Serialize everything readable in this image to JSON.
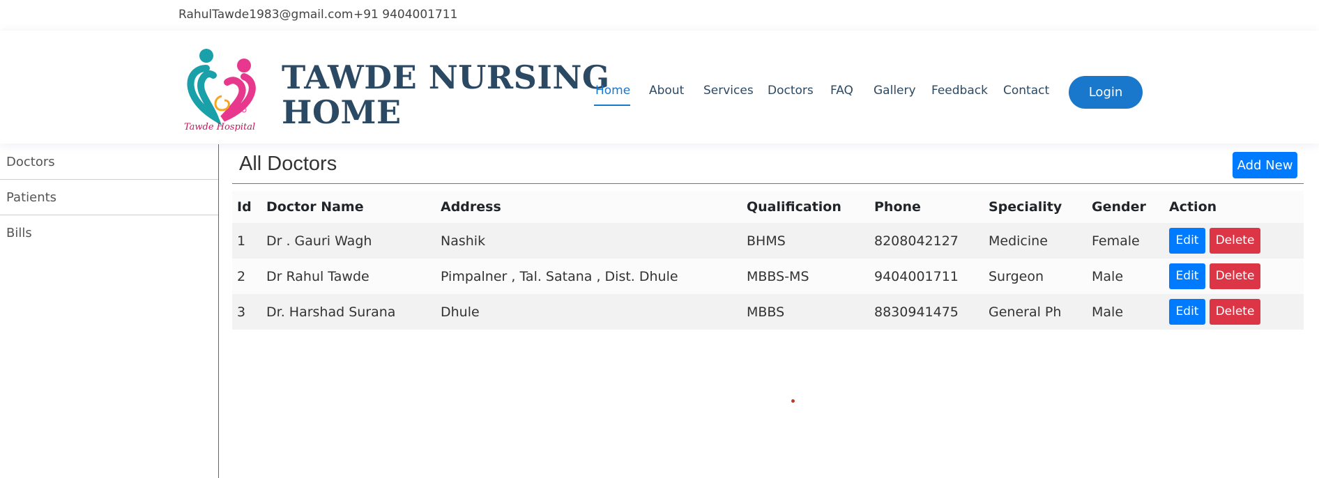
{
  "topbar": {
    "email": "RahulTawde1983@gmail.com",
    "phone": "+91 9404001711"
  },
  "header": {
    "brand_line1": "TAWDE NURSING",
    "brand_line2": "HOME",
    "logo_caption": "Tawde Hospital",
    "nav": [
      "Home",
      "About",
      "Services",
      "Doctors",
      "FAQ",
      "Gallery",
      "Feedback",
      "Contact"
    ],
    "active_nav": "Home",
    "login_label": "Login"
  },
  "sidebar": {
    "items": [
      {
        "label": "Doctors"
      },
      {
        "label": "Patients"
      },
      {
        "label": "Bills"
      }
    ]
  },
  "main": {
    "title": "All Doctors",
    "add_label": "Add New",
    "columns": [
      "Id",
      "Doctor Name",
      "Address",
      "Qualification",
      "Phone",
      "Speciality",
      "Gender",
      "Action"
    ],
    "rows": [
      {
        "id": "1",
        "name": "Dr . Gauri Wagh",
        "address": "Nashik",
        "qualification": "BHMS",
        "phone": "8208042127",
        "speciality": "Medicine",
        "gender": "Female"
      },
      {
        "id": "2",
        "name": "Dr Rahul Tawde",
        "address": "Pimpalner , Tal. Satana , Dist. Dhule",
        "qualification": "MBBS-MS",
        "phone": "9404001711",
        "speciality": "Surgeon",
        "gender": "Male"
      },
      {
        "id": "3",
        "name": "Dr. Harshad Surana",
        "address": "Dhule",
        "qualification": "MBBS",
        "phone": "8830941475",
        "speciality": "General Ph",
        "gender": "Male"
      }
    ],
    "edit_label": "Edit",
    "delete_label": "Delete"
  },
  "colors": {
    "brand_navy": "#2c4964",
    "accent_blue": "#1977cc",
    "primary_button": "#007bff",
    "danger_button": "#dc3545",
    "rule_green": "#28a745"
  },
  "icons": {
    "logo": "tawde-hospital-logo"
  }
}
